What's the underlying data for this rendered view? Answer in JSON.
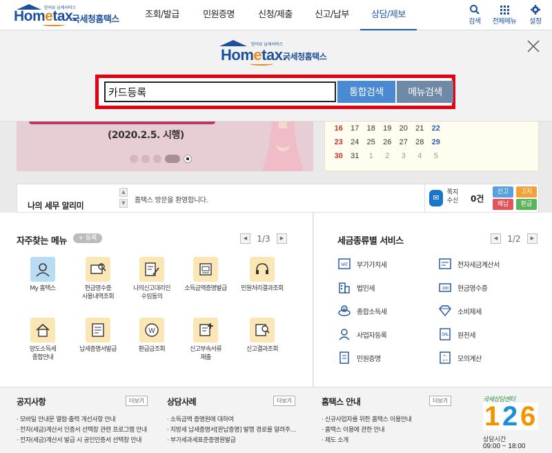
{
  "header": {
    "logo_small": "믿어요 납세서비스",
    "logo_main_prefix": "Hom",
    "logo_main_e": "e",
    "logo_main_suffix": "tax.",
    "logo_korean": "국세청홈택스",
    "nav": [
      {
        "label": "조회/발급",
        "active": false
      },
      {
        "label": "민원증명",
        "active": false
      },
      {
        "label": "신청/제출",
        "active": false
      },
      {
        "label": "신고/납부",
        "active": false
      },
      {
        "label": "상담/제보",
        "active": true
      }
    ],
    "utils": {
      "search": "검색",
      "all_menu": "전체메뉴",
      "settings": "설정"
    }
  },
  "search_overlay": {
    "input_value": "카드등록",
    "integrated_search": "통합검색",
    "menu_search": "메뉴검색"
  },
  "banner": {
    "text": "(2020.2.5. 시행)"
  },
  "calendar": {
    "rows": [
      [
        "16",
        "17",
        "18",
        "19",
        "20",
        "21",
        "22"
      ],
      [
        "23",
        "24",
        "25",
        "26",
        "27",
        "28",
        "29"
      ],
      [
        "30",
        "31",
        "1",
        "2",
        "3",
        "4",
        "5"
      ]
    ]
  },
  "notice": {
    "title": "나의 세무 알리미",
    "message": "홈택스 방문을 환영합니다.",
    "mail_label": "쪽지 수신",
    "mail_count": "0건",
    "badges": {
      "report": "신고",
      "notify": "고지",
      "arrears": "체납",
      "refund": "환급"
    }
  },
  "favorites": {
    "title": "자주찾는 메뉴",
    "register": "+ 등록",
    "page": "1/3",
    "items": [
      {
        "label": "My 홈택스",
        "icon": "person-icon"
      },
      {
        "label": "현금영수증\n사용내역조회",
        "icon": "receipt-search-icon"
      },
      {
        "label": "나의신고대리인\n수임동의",
        "icon": "agent-consent-icon"
      },
      {
        "label": "소득금액증명발급",
        "icon": "certificate-icon"
      },
      {
        "label": "민원처리결과조회",
        "icon": "headset-icon"
      },
      {
        "label": "양도소득세\n종합안내",
        "icon": "house-icon"
      },
      {
        "label": "납세증명서발급",
        "icon": "document-icon"
      },
      {
        "label": "환급금조회",
        "icon": "refund-icon"
      },
      {
        "label": "신고부속서류\n제출",
        "icon": "document-add-icon"
      },
      {
        "label": "신고결과조회",
        "icon": "result-search-icon"
      }
    ]
  },
  "tax_services": {
    "title": "세금종류별 서비스",
    "page": "1/2",
    "items": [
      {
        "label": "부가가치세",
        "icon": "vat-icon"
      },
      {
        "label": "전자세금계산서",
        "icon": "e-invoice-icon"
      },
      {
        "label": "법인세",
        "icon": "building-icon"
      },
      {
        "label": "현금영수증",
        "icon": "cash-receipt-icon"
      },
      {
        "label": "종합소득세",
        "icon": "income-tax-icon"
      },
      {
        "label": "소비제세",
        "icon": "diamond-icon"
      },
      {
        "label": "사업자등록",
        "icon": "business-person-icon"
      },
      {
        "label": "원천세",
        "icon": "withholding-icon"
      },
      {
        "label": "민원증명",
        "icon": "civil-doc-icon"
      },
      {
        "label": "모의계산",
        "icon": "calculator-icon"
      }
    ]
  },
  "footer": {
    "more": "더보기",
    "notices": {
      "title": "공지사항",
      "items": [
        "모바일 안내문 열람·출력 개선사항 안내",
        "전자(세금)계산서 인증서 선택창 관련 프로그램 안내",
        "전자(세금)계산서 발급 시 공인인증서 선택창 안내"
      ]
    },
    "cases": {
      "title": "상담사례",
      "items": [
        "소득금액 증명원에 대하여",
        "지방세 납세증명서[완납증명] 발행 경로를 알려주세요",
        "부가세과세표준증명원발급"
      ]
    },
    "guide": {
      "title": "홈택스 안내",
      "items": [
        "신규사업자를 위한 홈택스 이용안내",
        "홈택스 이용에 관한 안내",
        "제도 소개"
      ]
    },
    "callcenter": {
      "title": "국세상담센터",
      "number": [
        "1",
        "2",
        "6"
      ],
      "hours_label": "상담시간",
      "hours": "09:00 ~ 18:00"
    }
  }
}
